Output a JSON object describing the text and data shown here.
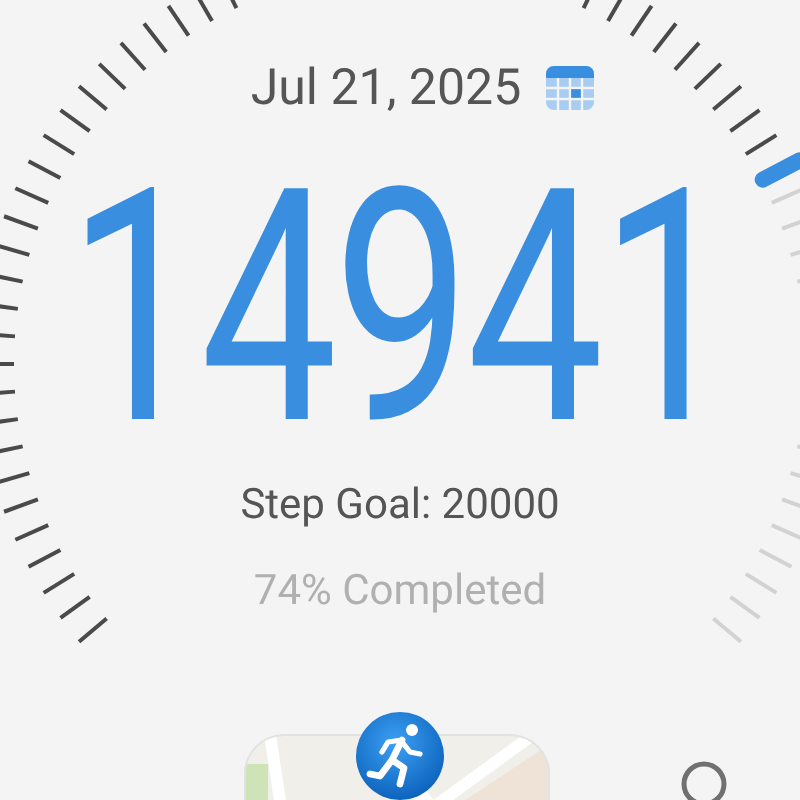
{
  "date": "Jul 21, 2025",
  "steps": "14941",
  "goal": "Step Goal: 20000",
  "completed": "74% Completed"
}
